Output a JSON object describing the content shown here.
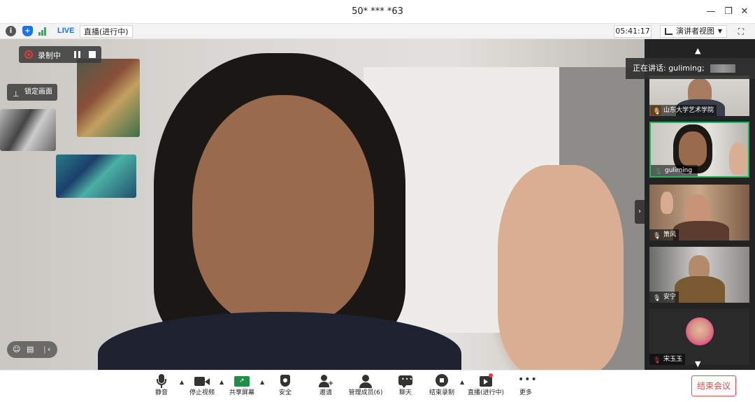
{
  "window": {
    "title": "50* *** *63",
    "minimize_glyph": "—",
    "restore_glyph": "❐",
    "close_glyph": "✕"
  },
  "infobar": {
    "info_icon": "info-icon",
    "shield_icon": "shield-icon",
    "signal_icon": "signal-icon",
    "live_badge": "LIVE",
    "live_status": "直播(进行中)",
    "elapsed_time": "05:41:17",
    "view_mode": "演讲者视图",
    "fullscreen_icon": "fullscreen-icon"
  },
  "recording": {
    "label": "录制中",
    "pause_icon": "pause-icon",
    "stop_icon": "stop-icon"
  },
  "overlay": {
    "lock_view_label": "锁定画面",
    "speaking_now": "正在讲话: guliming;"
  },
  "participants": [
    {
      "name": "山东大学艺术学院",
      "host": true,
      "active": false
    },
    {
      "name": "guliming",
      "host": false,
      "active": true
    },
    {
      "name": "箫风",
      "host": false,
      "active": false
    },
    {
      "name": "安宁",
      "host": false,
      "active": false
    },
    {
      "name": "宋玉玉",
      "host": false,
      "active": false
    }
  ],
  "toolbar": {
    "mute": "静音",
    "stop_video": "停止视频",
    "share_screen": "共享屏幕",
    "security": "安全",
    "invite": "邀请",
    "manage_participants": "管理成员(6)",
    "chat": "聊天",
    "end_recording": "结束录制",
    "live_stream": "直播(进行中)",
    "more": "更多",
    "end_meeting": "结束会议"
  },
  "colors": {
    "accent_green": "#1db954",
    "live_blue": "#1a73e8",
    "end_red": "#e24a4a",
    "recording_red": "#e23b3b",
    "host_orange": "#f28b1d"
  }
}
